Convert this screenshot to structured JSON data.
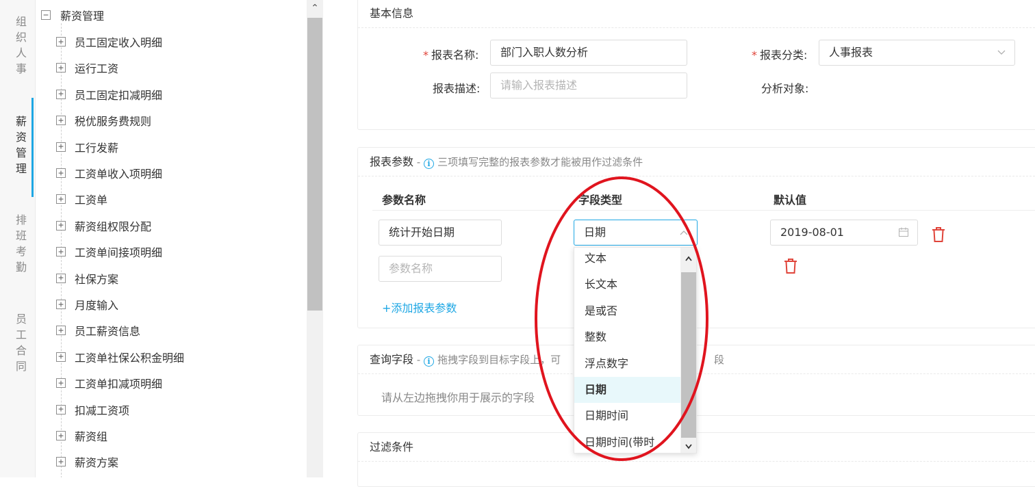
{
  "rail": {
    "items": [
      {
        "chars": [
          "组",
          "织",
          "人",
          "事"
        ],
        "active": false
      },
      {
        "chars": [
          "薪",
          "资",
          "管",
          "理"
        ],
        "active": true
      },
      {
        "chars": [
          "排",
          "班",
          "考",
          "勤"
        ],
        "active": false
      },
      {
        "chars": [
          "员",
          "工",
          "合",
          "同"
        ],
        "active": false
      }
    ]
  },
  "tree": {
    "root": {
      "label": "薪资管理",
      "toggle": "−"
    },
    "items": [
      {
        "label": "员工固定收入明细"
      },
      {
        "label": "运行工资"
      },
      {
        "label": "员工固定扣减明细"
      },
      {
        "label": "税优服务费规则"
      },
      {
        "label": "工行发薪"
      },
      {
        "label": "工资单收入项明细"
      },
      {
        "label": "工资单"
      },
      {
        "label": "薪资组权限分配"
      },
      {
        "label": "工资单间接项明细"
      },
      {
        "label": "社保方案"
      },
      {
        "label": "月度输入"
      },
      {
        "label": "员工薪资信息"
      },
      {
        "label": "工资单社保公积金明细"
      },
      {
        "label": "工资单扣减项明细"
      },
      {
        "label": "扣减工资项"
      },
      {
        "label": "薪资组"
      },
      {
        "label": "薪资方案"
      }
    ],
    "expand_glyph": "+"
  },
  "basic": {
    "title": "基本信息",
    "name_label": "报表名称:",
    "name_value": "部门入职人数分析",
    "category_label": "报表分类:",
    "category_value": "人事报表",
    "desc_label": "报表描述:",
    "desc_placeholder": "请输入报表描述",
    "target_label": "分析对象:",
    "required_mark": "*"
  },
  "params": {
    "title": "报表参数",
    "sep": " - ",
    "hint": "三项填写完整的报表参数才能被用作过滤条件",
    "col_name": "参数名称",
    "col_type": "字段类型",
    "col_default": "默认值",
    "rows": [
      {
        "name": "统计开始日期",
        "type": "日期",
        "default": "2019-08-01"
      },
      {
        "name_placeholder": "参数名称"
      }
    ],
    "add_label": "+添加报表参数"
  },
  "query": {
    "title": "查询字段",
    "sep": " - ",
    "hint_left": "拖拽字段到目标字段上，可",
    "hint_right": "段",
    "empty": "请从左边拖拽你用于展示的字段"
  },
  "filter": {
    "title": "过滤条件"
  },
  "dropdown": {
    "options": [
      "文本",
      "长文本",
      "是或否",
      "整数",
      "浮点数字",
      "日期",
      "日期时间",
      "日期时间(带时"
    ],
    "selected": "日期"
  },
  "colors": {
    "accent": "#1ea7e4",
    "danger": "#e0443a",
    "annotation": "#e0141e",
    "selected_bg": "#e8f8fb"
  }
}
